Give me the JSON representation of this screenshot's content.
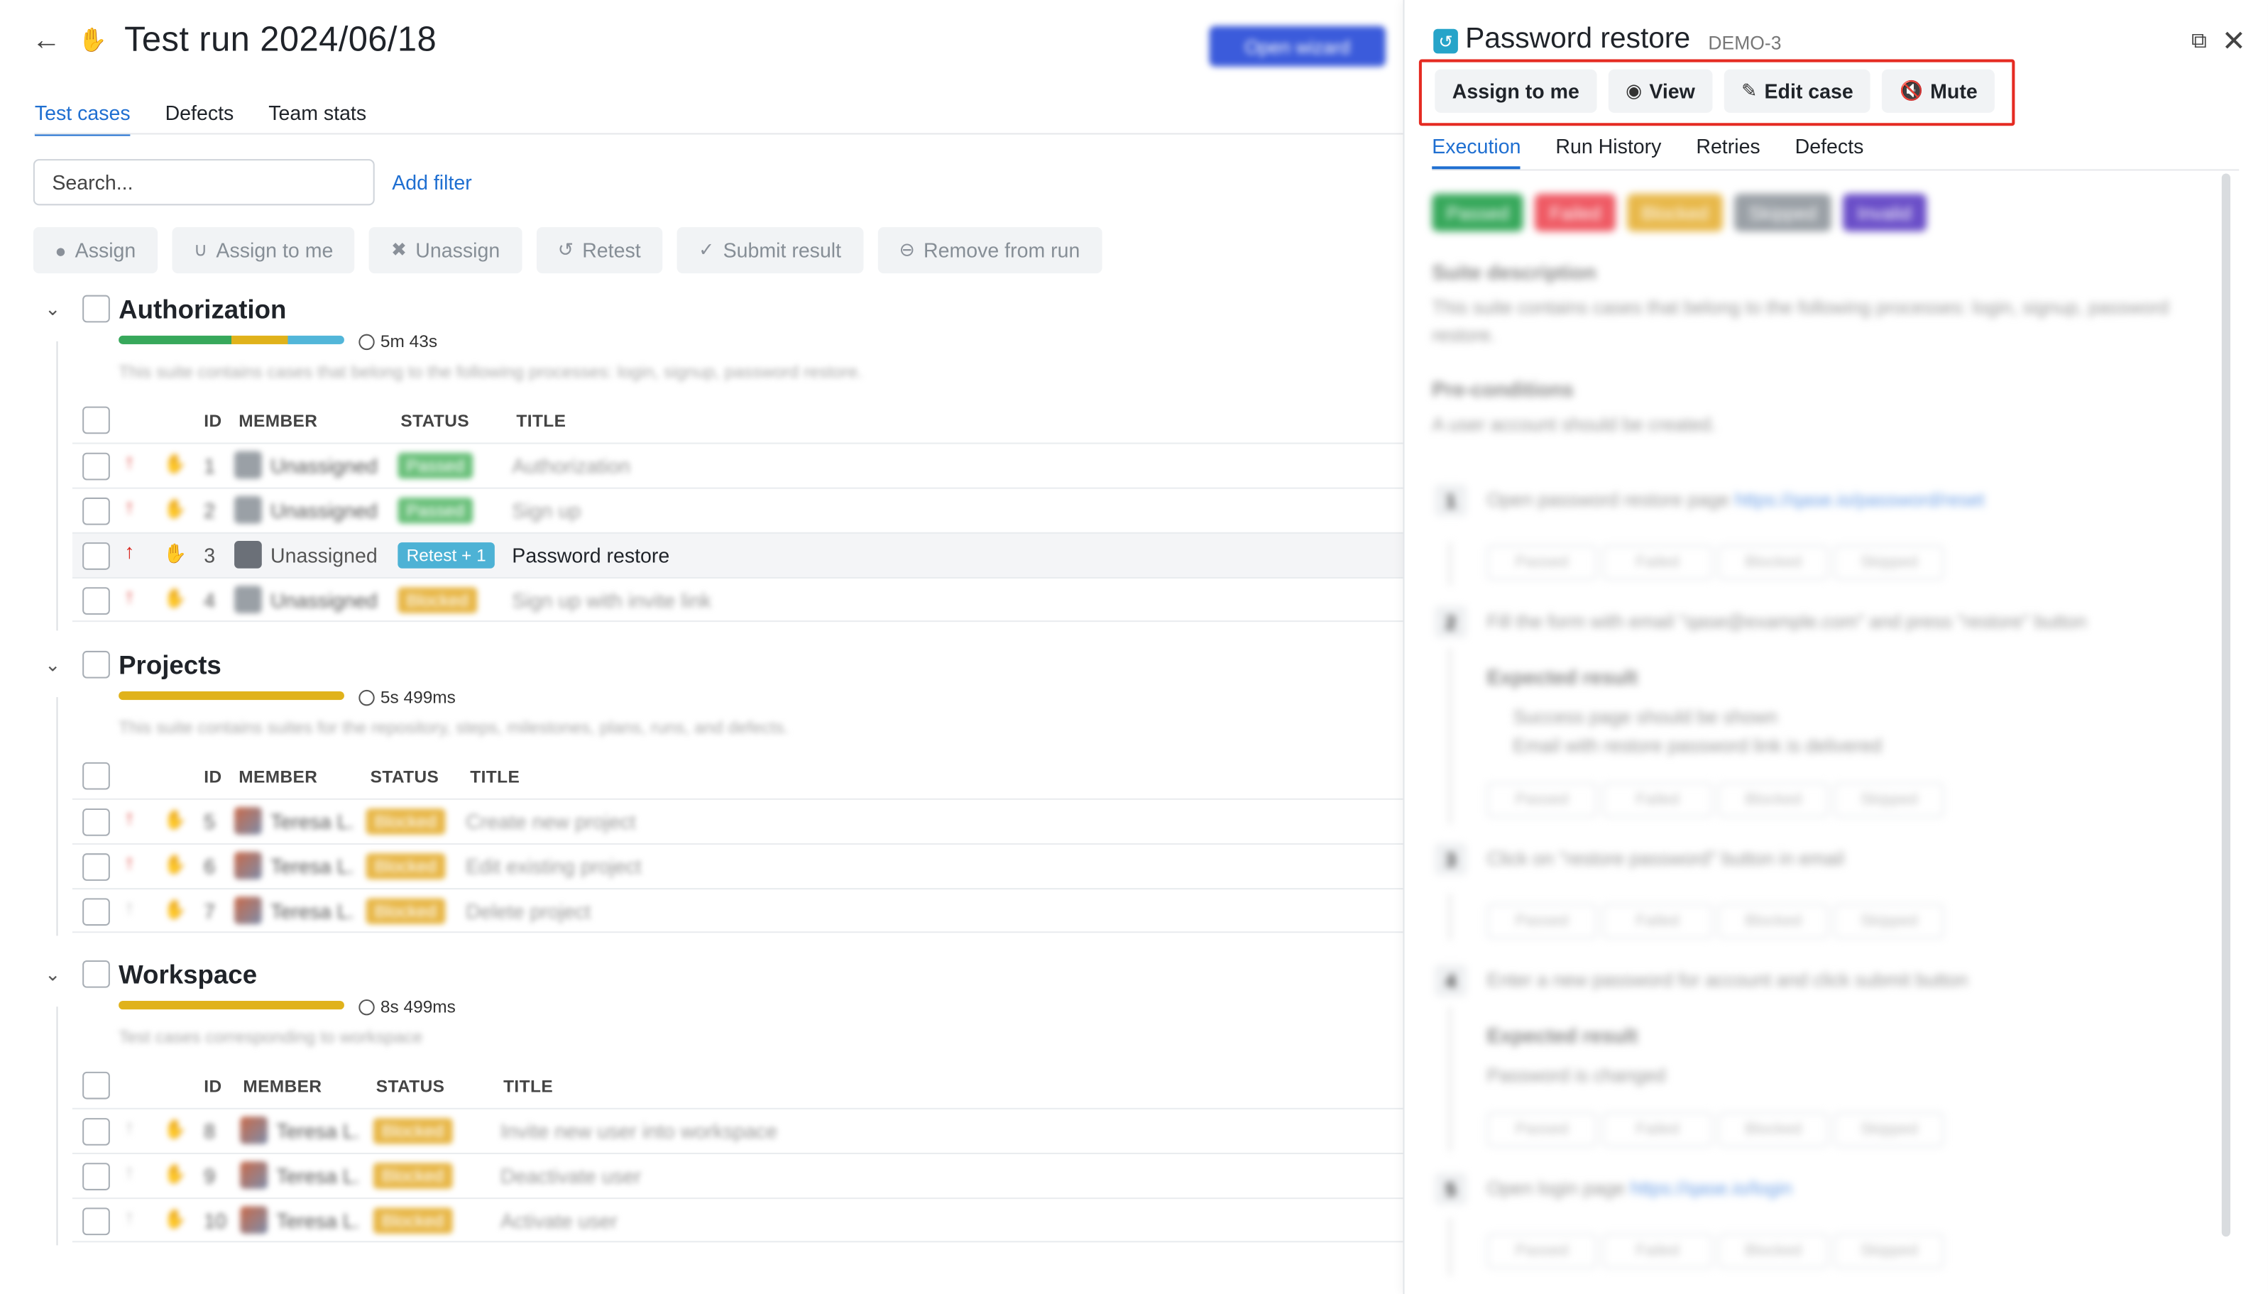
{
  "header": {
    "back_icon": "arrow-left-icon",
    "hand_icon": "hand-icon",
    "title": "Test run 2024/06/18",
    "open_wizard_label": "Open wizard"
  },
  "tabs": [
    {
      "label": "Test cases",
      "active": true
    },
    {
      "label": "Defects",
      "active": false
    },
    {
      "label": "Team stats",
      "active": false
    }
  ],
  "search": {
    "placeholder": "Search..."
  },
  "add_filter_label": "Add filter",
  "toolbar": {
    "assign": "Assign",
    "assign_to_me": "Assign to me",
    "unassign": "Unassign",
    "retest": "Retest",
    "submit_result": "Submit result",
    "remove_from_run": "Remove from run"
  },
  "suites": [
    {
      "title": "Authorization",
      "time": "5m 43s",
      "description": "This suite contains cases that belong to the following processes: login, signup, password restore.",
      "progress": [
        {
          "color": "#37a85b",
          "share": 0.5
        },
        {
          "color": "#e0b21b",
          "share": 0.25
        },
        {
          "color": "#52b6d9",
          "share": 0.25
        }
      ],
      "columns": [
        "ID",
        "MEMBER",
        "STATUS",
        "TITLE"
      ],
      "rows": [
        {
          "id": "1",
          "member": "Unassigned",
          "status": "Passed",
          "title": "Authorization",
          "blurred": true
        },
        {
          "id": "2",
          "member": "Unassigned",
          "status": "Passed",
          "title": "Sign up",
          "blurred": true
        },
        {
          "id": "3",
          "member": "Unassigned",
          "status": "Retest + 1",
          "title": "Password restore",
          "blurred": false
        },
        {
          "id": "4",
          "member": "Unassigned",
          "status": "Blocked",
          "title": "Sign up with invite link",
          "blurred": true
        }
      ]
    },
    {
      "title": "Projects",
      "time": "5s 499ms",
      "description": "This suite contains suites for the repository, steps, milestones, plans, runs, and defects.",
      "progress": [
        {
          "color": "#e0b21b",
          "share": 1
        }
      ],
      "columns": [
        "ID",
        "MEMBER",
        "STATUS",
        "TITLE"
      ],
      "rows": [
        {
          "id": "5",
          "member": "Teresa L.",
          "status": "Blocked",
          "title": "Create new project",
          "blurred": true
        },
        {
          "id": "6",
          "member": "Teresa L.",
          "status": "Blocked",
          "title": "Edit existing project",
          "blurred": true
        },
        {
          "id": "7",
          "member": "Teresa L.",
          "status": "Blocked",
          "title": "Delete project",
          "blurred": true
        }
      ]
    },
    {
      "title": "Workspace",
      "time": "8s 499ms",
      "description": "Test cases corresponding to workspace",
      "progress": [
        {
          "color": "#e0b21b",
          "share": 1
        }
      ],
      "columns": [
        "ID",
        "MEMBER",
        "STATUS",
        "TITLE"
      ],
      "rows": [
        {
          "id": "8",
          "member": "Teresa L.",
          "status": "Blocked",
          "title": "Invite new user into workspace",
          "blurred": true
        },
        {
          "id": "9",
          "member": "Teresa L.",
          "status": "Blocked",
          "title": "Deactivate user",
          "blurred": true
        },
        {
          "id": "10",
          "member": "Teresa L.",
          "status": "Blocked",
          "title": "Activate user",
          "blurred": true
        }
      ]
    }
  ],
  "panel": {
    "title": "Password restore",
    "case_id": "DEMO-3",
    "buttons": {
      "assign_to_me": "Assign to me",
      "view": "View",
      "edit_case": "Edit case",
      "mute": "Mute"
    },
    "tabs": [
      {
        "label": "Execution",
        "active": true
      },
      {
        "label": "Run History",
        "active": false
      },
      {
        "label": "Retries",
        "active": false
      },
      {
        "label": "Defects",
        "active": false
      }
    ],
    "status_chips": [
      {
        "label": "Passed",
        "color": "#37a85b"
      },
      {
        "label": "Failed",
        "color": "#ef5a64"
      },
      {
        "label": "Blocked",
        "color": "#e8b84a"
      },
      {
        "label": "Skipped",
        "color": "#9aa0a6"
      },
      {
        "label": "Invalid",
        "color": "#6a4ec8"
      }
    ],
    "suite_description_heading": "Suite description",
    "suite_description": "This suite contains cases that belong to the following processes: login, signup, password restore.",
    "preconditions_heading": "Pre-conditions",
    "preconditions": "A user account should be created.",
    "step_buttons": [
      "Passed",
      "Failed",
      "Blocked",
      "Skipped"
    ],
    "steps": [
      {
        "num": "1",
        "text": "Open password restore page",
        "link": "https://qase.io/password/reset"
      },
      {
        "num": "2",
        "text": "Fill the form with email \"qase@example.com\" and press \"restore\" button",
        "expected_heading": "Expected result",
        "expected": [
          "Success page should be shown",
          "Email with restore password link is delivered"
        ]
      },
      {
        "num": "3",
        "text": "Click on \"restore password\" button in email"
      },
      {
        "num": "4",
        "text": "Enter a new password for account and click submit button",
        "expected_heading": "Expected result",
        "expected": [
          "Password is changed"
        ]
      },
      {
        "num": "5",
        "text": "Open login page",
        "link": "https://qase.io/login"
      }
    ]
  }
}
